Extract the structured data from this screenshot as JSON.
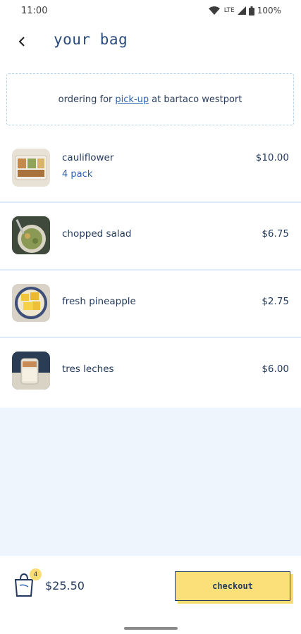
{
  "status": {
    "time": "11:00",
    "network": "LTE",
    "battery": "100%"
  },
  "header": {
    "title": "your bag",
    "back_icon": "chevron-left-icon"
  },
  "order": {
    "prefix": "ordering for",
    "method": "pick-up",
    "suffix": "at bartaco westport"
  },
  "items": [
    {
      "name": "cauliflower",
      "sub": "4 pack",
      "price": "$10.00"
    },
    {
      "name": "chopped salad",
      "price": "$6.75"
    },
    {
      "name": "fresh pineapple",
      "price": "$2.75"
    },
    {
      "name": "tres leches",
      "price": "$6.00"
    }
  ],
  "footer": {
    "bag_count": "4",
    "total": "$25.50",
    "checkout_label": "checkout"
  },
  "colors": {
    "brand_navy": "#233a5e",
    "accent_yellow": "#fbe07a",
    "link_blue": "#2f66b0",
    "light_blue_bg": "#eef5fc"
  }
}
